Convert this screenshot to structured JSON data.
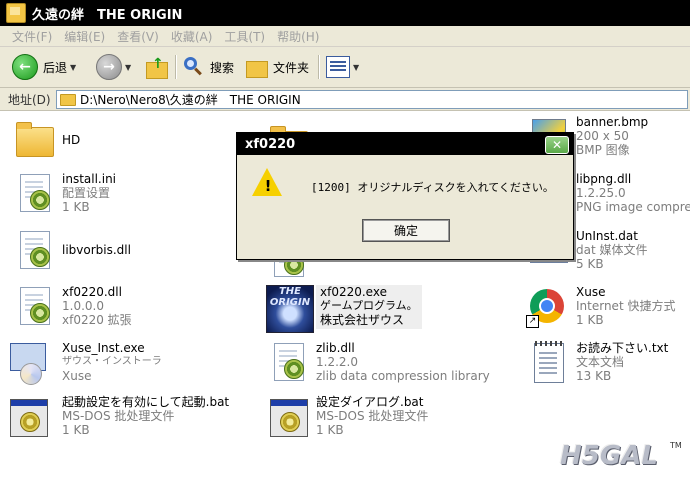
{
  "window": {
    "title": "久遠の絆　THE ORIGIN"
  },
  "menu": [
    "文件(F)",
    "编辑(E)",
    "查看(V)",
    "收藏(A)",
    "工具(T)",
    "帮助(H)"
  ],
  "toolbar": {
    "back": "后退",
    "search": "搜索",
    "folders": "文件夹"
  },
  "address": {
    "label": "地址(D)",
    "path": "D:\\Nero\\Nero8\\久遠の絆　THE ORIGIN"
  },
  "files": [
    {
      "name": "HD",
      "icon": "folder-icon"
    },
    {
      "name": "install.ini",
      "sub1": "配置设置",
      "sub2": "1 KB",
      "icon": "config-file-icon"
    },
    {
      "name": "libvorbis.dll",
      "icon": "dll-file-icon"
    },
    {
      "name": "xf0220.dll",
      "sub1": "1.0.0.0",
      "sub2": "xf0220 拡張",
      "icon": "dll-file-icon"
    },
    {
      "name": "Xuse_Inst.exe",
      "sub1": "ザウス・インストーラ",
      "sub2": "Xuse",
      "icon": "installer-icon"
    },
    {
      "name": "起動設定を有効にして起動.bat",
      "sub1": "MS-DOS 批处理文件",
      "sub2": "1 KB",
      "icon": "batch-file-icon"
    },
    {
      "name": "xf0220.exe",
      "sub1": "ゲームプログラム。",
      "sub2": "株式会社ザウス",
      "icon": "origin-exe-icon"
    },
    {
      "name": "zlib.dll",
      "sub1": "1.2.2.0",
      "sub2": "zlib data compression library",
      "icon": "dll-file-icon"
    },
    {
      "name": "設定ダイアログ.bat",
      "sub1": "MS-DOS 批处理文件",
      "sub2": "1 KB",
      "icon": "batch-file-icon"
    },
    {
      "name": "banner.bmp",
      "sub1": "200 x 50",
      "sub2": "BMP 图像",
      "icon": "bitmap-icon"
    },
    {
      "name": "libpng.dll",
      "sub1": "1.2.25.0",
      "sub2": "PNG image compress",
      "icon": "dll-file-icon"
    },
    {
      "name": "UnInst.dat",
      "sub1": "dat 媒体文件",
      "sub2": "5 KB",
      "icon": "dat-file-icon"
    },
    {
      "name": "Xuse",
      "sub1": "Internet 快捷方式",
      "sub2": "1 KB",
      "icon": "chrome-icon"
    },
    {
      "name": "お読み下さい.txt",
      "sub1": "文本文档",
      "sub2": "13 KB",
      "icon": "notepad-icon"
    }
  ],
  "dialog": {
    "title": "xf0220",
    "message": "[1200] オリジナルディスクを入れてください。",
    "ok": "确定"
  },
  "watermark": "H5GAL",
  "trademark": "TM"
}
